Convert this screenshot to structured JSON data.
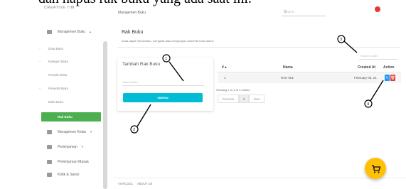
{
  "caption": "dan hapus rak buku yang ada saat ini.",
  "brand": "CREATIVE TIM",
  "sidebar": {
    "items": [
      {
        "label": "Manajemen Buku",
        "caret": "▴",
        "icon": "book-icon"
      },
      {
        "label": "Manajemen Kelas",
        "caret": "▾",
        "icon": "class-icon"
      },
      {
        "label": "Peminjaman",
        "caret": "▾",
        "icon": "borrow-icon"
      },
      {
        "label": "Peminjaman Masuk",
        "icon": "inbox-icon"
      },
      {
        "label": "Kritik & Saran",
        "icon": "feedback-icon"
      }
    ],
    "subitems": [
      "Data Buku",
      "Kategori Buku",
      "Penulis Buku",
      "Penerbit Buku",
      "Edisi Buku"
    ],
    "active": "Rak Buku"
  },
  "topbar": {
    "title": "Manajemen Buku",
    "search_placeholder": "Search..."
  },
  "header": {
    "title": "Rak Buku",
    "description": "Anda dapat menambah, mengedit atau menghapus data Rak buku disini !"
  },
  "form": {
    "title": "Tambah Rak Buku",
    "input_placeholder": "Nama Buku",
    "submit_label": "SIMPAN"
  },
  "table": {
    "search_placeholder": "Search Lakes",
    "columns": [
      "# ▴",
      "Nama",
      "Created At",
      "Action"
    ],
    "rows": [
      {
        "no": "1",
        "name": "RAK 001",
        "created": "February 09, 21"
      }
    ],
    "showing": "Showing 1 to 1 of 1 entries",
    "pagination": {
      "prev": "Previous",
      "page": "1",
      "next": "Next"
    }
  },
  "footer": {
    "links": [
      "VIVACOOL",
      "ABOUT US"
    ]
  },
  "annotations": [
    "1",
    "2",
    "3",
    "4"
  ],
  "colors": {
    "sidebar_active": "#4caf50",
    "submit_button": "#00bcd4",
    "edit_button": "#2196f3",
    "delete_button": "#e53935",
    "fab": "#ffc107"
  }
}
